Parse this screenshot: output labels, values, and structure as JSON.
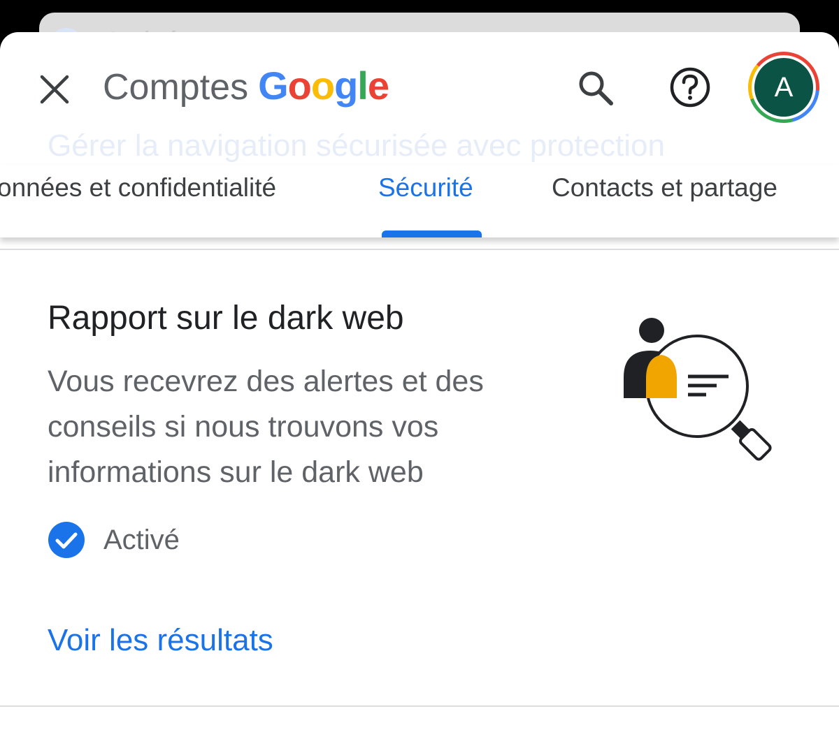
{
  "behind_sheet": {
    "status_label": "Activé"
  },
  "header": {
    "ghost_text": "Gérer la navigation sécurisée avec protection",
    "title_prefix": "Comptes",
    "brand": {
      "letters": [
        "G",
        "o",
        "o",
        "g",
        "l",
        "e"
      ],
      "colors": [
        "#4285f4",
        "#ea4335",
        "#fbbc05",
        "#4285f4",
        "#34a853",
        "#ea4335"
      ]
    },
    "avatar_letter": "A"
  },
  "tabs": [
    {
      "label": "onnées et confidentialité",
      "active": false
    },
    {
      "label": "Sécurité",
      "active": true
    },
    {
      "label": "Contacts et partage",
      "active": false
    }
  ],
  "card": {
    "title": "Rapport sur le dark web",
    "description": "Vous recevrez des alertes et des conseils si nous trouvons vos informations sur le dark web",
    "status_label": "Activé",
    "link_label": "Voir les résultats"
  },
  "colors": {
    "accent": "#1a73e8",
    "text_primary": "#202124",
    "text_secondary": "#5f6368",
    "avatar_bg": "#0b5345",
    "illustration_orange": "#f0a500"
  },
  "icons": {
    "close": "close-icon",
    "search": "search-icon",
    "help": "help-icon",
    "check": "check-circle-icon",
    "illustration": "dark-web-magnifier-illustration"
  }
}
